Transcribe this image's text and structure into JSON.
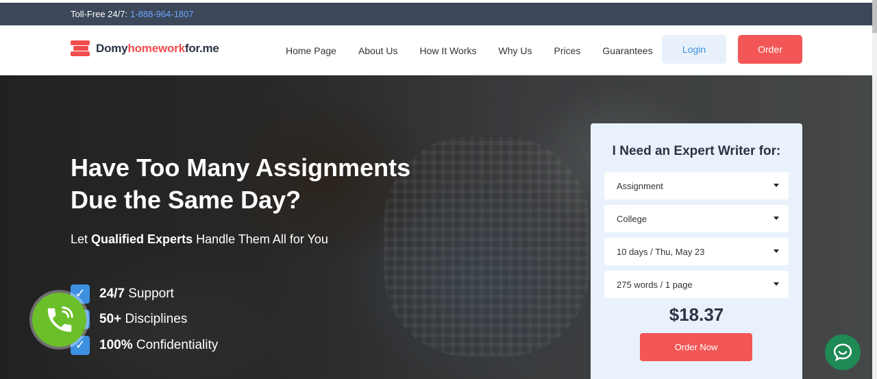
{
  "topbar": {
    "label": "Toll-Free 24/7:",
    "phone": "1-888-964-1807"
  },
  "logo": {
    "part1": "Do",
    "part2": "my",
    "part3": "homework",
    "part4": "for.me"
  },
  "nav": [
    {
      "label": "Home Page"
    },
    {
      "label": "About Us"
    },
    {
      "label": "How It Works"
    },
    {
      "label": "Why Us"
    },
    {
      "label": "Prices"
    },
    {
      "label": "Guarantees"
    }
  ],
  "header": {
    "login_label": "Login",
    "order_label": "Order"
  },
  "hero": {
    "title_line1": "Have Too Many Assignments",
    "title_line2": "Due the Same Day?",
    "sub_prefix": "Let ",
    "sub_bold": "Qualified Experts",
    "sub_suffix": " Handle Them All for You",
    "features": [
      {
        "bold": "24/7",
        "text": " Support"
      },
      {
        "bold": "50+",
        "text": " Disciplines"
      },
      {
        "bold": "100%",
        "text": " Confidentiality"
      }
    ]
  },
  "calculator": {
    "title": "I Need an Expert Writer for:",
    "type_value": "Assignment",
    "level_value": "College",
    "deadline_value": "10 days / Thu, May 23",
    "pages_value": "275 words / 1 page",
    "price": "$18.37",
    "order_now_label": "Order Now"
  },
  "colors": {
    "brand_red": "#f25656",
    "brand_blue": "#3d8fe0",
    "topbar_bg": "#3c4759",
    "call_green": "#6bbf2a",
    "chat_green": "#1e8a55"
  },
  "icons": {
    "logo": "books-stack-icon",
    "check": "checkmark-icon",
    "call": "phone-call-icon",
    "chat": "chat-bubble-icon",
    "caret": "caret-down-icon"
  }
}
